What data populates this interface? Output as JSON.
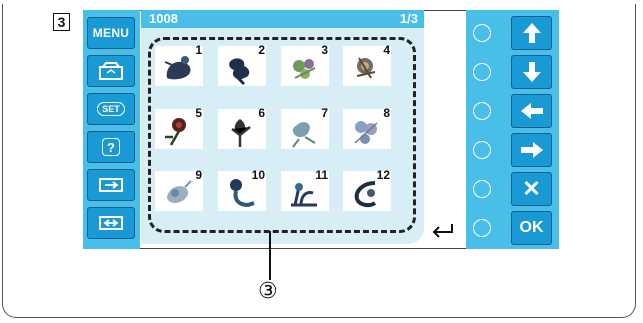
{
  "step_label": "3",
  "title": {
    "pattern_code": "1008",
    "page_indicator": "1/3"
  },
  "left_buttons": [
    {
      "name": "menu-button",
      "label": "MENU",
      "icon": "text"
    },
    {
      "name": "hoop-button",
      "label": "",
      "icon": "embroidery-frame-icon"
    },
    {
      "name": "set-button",
      "label": "SET",
      "icon": "set-icon"
    },
    {
      "name": "help-button",
      "label": "?",
      "icon": "help-icon"
    },
    {
      "name": "layout-button-1",
      "label": "",
      "icon": "arrow-box-icon"
    },
    {
      "name": "layout-button-2",
      "label": "",
      "icon": "arrow-box-icon"
    }
  ],
  "patterns": [
    {
      "number": "1",
      "icon": "floral-bird-motif"
    },
    {
      "number": "2",
      "icon": "floral-motif"
    },
    {
      "number": "3",
      "icon": "floral-motif"
    },
    {
      "number": "4",
      "icon": "floral-motif"
    },
    {
      "number": "5",
      "icon": "floral-motif"
    },
    {
      "number": "6",
      "icon": "floral-motif"
    },
    {
      "number": "7",
      "icon": "floral-motif"
    },
    {
      "number": "8",
      "icon": "floral-motif"
    },
    {
      "number": "9",
      "icon": "floral-motif"
    },
    {
      "number": "10",
      "icon": "floral-motif"
    },
    {
      "number": "11",
      "icon": "floral-motif"
    },
    {
      "number": "12",
      "icon": "floral-motif"
    }
  ],
  "right_buttons": [
    {
      "name": "up-button",
      "icon": "arrow-up-icon"
    },
    {
      "name": "down-button",
      "icon": "arrow-down-icon"
    },
    {
      "name": "left-button",
      "icon": "arrow-left-icon"
    },
    {
      "name": "right-button",
      "icon": "arrow-right-icon"
    },
    {
      "name": "cancel-button",
      "label": "✕",
      "icon": "close-icon"
    },
    {
      "name": "ok-button",
      "label": "OK",
      "icon": "text"
    }
  ],
  "return_symbol": "↵",
  "callout_label": "③",
  "colors": {
    "panel": "#48bee8",
    "button": "#1a9ad4",
    "grid_bg": "#d8eef6"
  }
}
